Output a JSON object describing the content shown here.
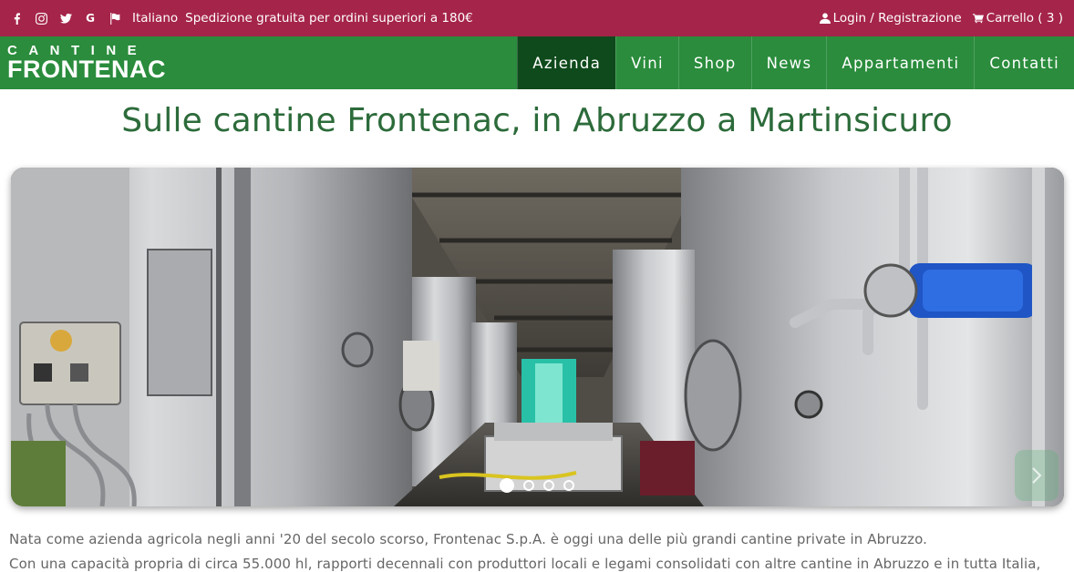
{
  "topbar": {
    "social_icons": [
      "facebook-icon",
      "instagram-icon",
      "twitter-icon",
      "google-icon"
    ],
    "language": "Italiano",
    "shipping_notice": "Spedizione gratuita per ordini superiori a 180€",
    "login": "Login / Registrazione",
    "cart": "Carrello ( 3 )",
    "background_color": "#a5244a"
  },
  "nav": {
    "logo_line1": "CANTINE",
    "logo_line2": "FRONTENAC",
    "items": [
      "Azienda",
      "Vini",
      "Shop",
      "News",
      "Appartamenti",
      "Contatti"
    ],
    "active_item": "Azienda",
    "background_color": "#2a8c3c",
    "active_color": "#0f4a1c"
  },
  "main": {
    "title": "Sulle cantine Frontenac, in Abruzzo a Martinsicuro",
    "slider": {
      "slide_count": 4,
      "active_slide": 1,
      "next_arrow_icon": "chevron-right-icon"
    },
    "paragraphs": [
      "Nata come azienda agricola negli anni '20 del secolo scorso, Frontenac S.p.A. è oggi una delle più grandi cantine private in Abruzzo.",
      "Con una capacità propria di circa 55.000 hl, rapporti decennali con produttori locali e legami consolidati con altre cantine in Abruzzo e in tutta Italia,"
    ]
  }
}
